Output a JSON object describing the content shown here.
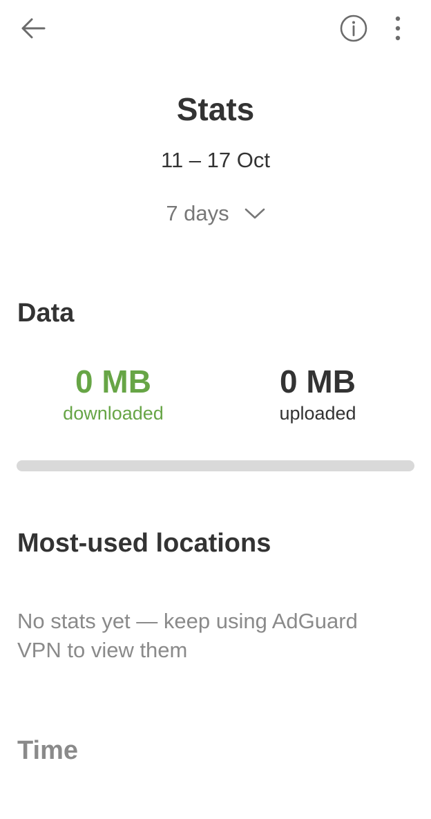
{
  "header": {
    "title": "Stats",
    "date_range": "11 – 17 Oct",
    "period": "7 days"
  },
  "data_section": {
    "title": "Data",
    "downloaded": {
      "value": "0 MB",
      "label": "downloaded"
    },
    "uploaded": {
      "value": "0 MB",
      "label": "uploaded"
    },
    "download_share": 0
  },
  "locations_section": {
    "title": "Most-used locations",
    "empty_message": "No stats yet — keep using AdGuard VPN to view them"
  },
  "time_section": {
    "title": "Time"
  },
  "icons": {
    "back": "arrow-left-icon",
    "info": "info-circle-icon",
    "more": "more-vertical-icon",
    "period_dropdown": "chevron-down-icon"
  },
  "colors": {
    "accent": "#67a546",
    "text_primary": "#333333",
    "text_secondary": "#8a8a8a",
    "bar_track": "#d9d9d9"
  }
}
